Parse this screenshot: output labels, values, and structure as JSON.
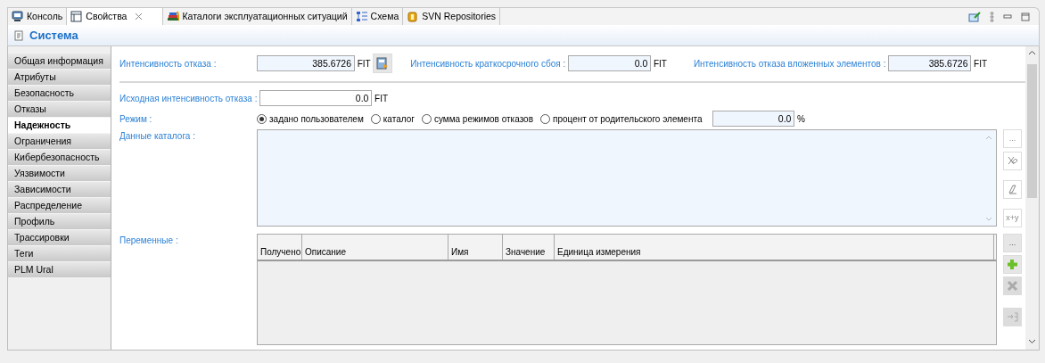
{
  "tabs": [
    {
      "label": "Консоль",
      "selected": false,
      "closable": false
    },
    {
      "label": "Свойства",
      "selected": true,
      "closable": true
    },
    {
      "label": "Каталоги эксплуатационных ситуаций",
      "selected": false,
      "closable": false
    },
    {
      "label": "Схема",
      "selected": false,
      "closable": false
    },
    {
      "label": "SVN Repositories",
      "selected": false,
      "closable": false
    }
  ],
  "title": "Система",
  "sidebar": {
    "items": [
      {
        "label": "Общая информация",
        "selected": false
      },
      {
        "label": "Атрибуты",
        "selected": false
      },
      {
        "label": "Безопасность",
        "selected": false
      },
      {
        "label": "Отказы",
        "selected": false
      },
      {
        "label": "Надежность",
        "selected": true
      },
      {
        "label": "Ограничения",
        "selected": false
      },
      {
        "label": "Кибербезопасность",
        "selected": false
      },
      {
        "label": "Уязвимости",
        "selected": false
      },
      {
        "label": "Зависимости",
        "selected": false
      },
      {
        "label": "Распределение",
        "selected": false
      },
      {
        "label": "Профиль",
        "selected": false
      },
      {
        "label": "Трассировки",
        "selected": false
      },
      {
        "label": "Теги",
        "selected": false
      },
      {
        "label": "PLM Ural",
        "selected": false
      }
    ]
  },
  "top_fields": [
    {
      "label": "Интенсивность отказа :",
      "value": "385.6726",
      "unit": "FIT",
      "readonly": true,
      "has_button": true
    },
    {
      "label": "Интенсивность краткосрочного сбоя :",
      "value": "0.0",
      "unit": "FIT",
      "readonly": true,
      "has_button": false
    },
    {
      "label": "Интенсивность отказа вложенных элементов :",
      "value": "385.6726",
      "unit": "FIT",
      "readonly": true,
      "has_button": false
    }
  ],
  "initial_field": {
    "label": "Исходная интенсивность отказа :",
    "value": "0.0",
    "unit": "FIT",
    "readonly": false
  },
  "mode": {
    "label": "Режим :",
    "options": [
      {
        "label": "задано пользователем",
        "selected": true
      },
      {
        "label": "каталог",
        "selected": false
      },
      {
        "label": "сумма режимов отказов",
        "selected": false
      },
      {
        "label": "процент от родительского элемента",
        "selected": false
      }
    ],
    "percent_value": "0.0",
    "percent_unit": "%"
  },
  "catalog": {
    "label": "Данные каталога :",
    "buttons": [
      {
        "kind": "text",
        "text": "...",
        "disabled": true
      },
      {
        "kind": "link",
        "disabled": true
      },
      {
        "kind": "eraser",
        "disabled": true
      },
      {
        "kind": "text",
        "text": "x+y",
        "disabled": true
      }
    ]
  },
  "variables": {
    "label": "Переменные :",
    "columns": [
      "Получено",
      "Описание",
      "Имя",
      "Значение",
      "Единица измерения"
    ],
    "buttons": [
      {
        "kind": "text",
        "text": "...",
        "disabled": false
      },
      {
        "kind": "add",
        "disabled": false
      },
      {
        "kind": "remove",
        "disabled": true
      },
      {
        "kind": "import",
        "disabled": true
      }
    ]
  }
}
